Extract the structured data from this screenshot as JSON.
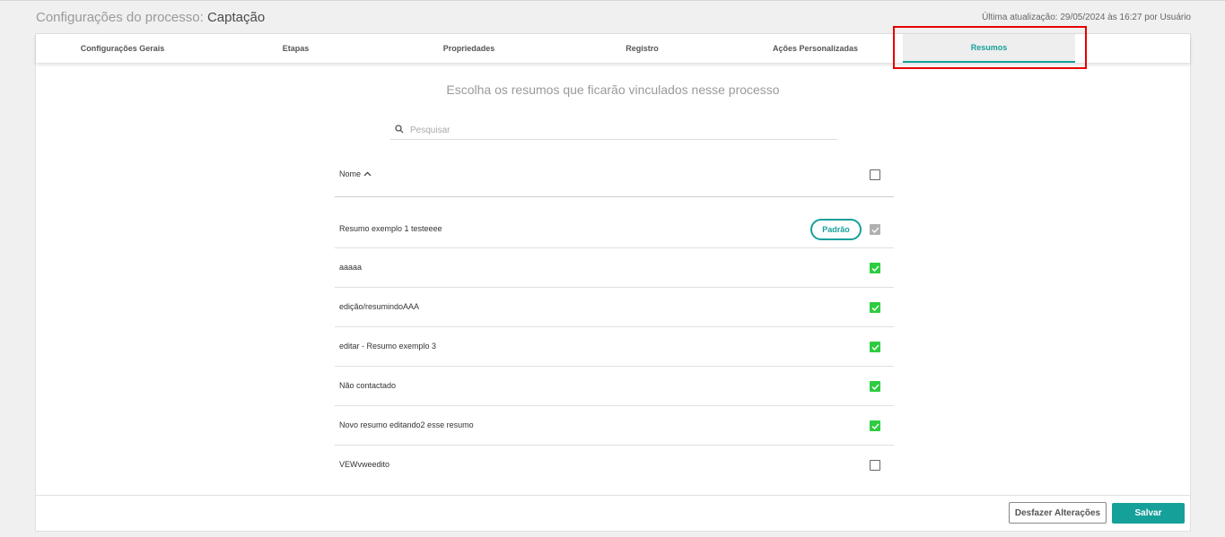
{
  "header": {
    "title_prefix": "Configurações do processo:",
    "title_name": "Captação",
    "last_update": "Última atualização: 29/05/2024 às 16:27 por Usuário"
  },
  "tabs": [
    {
      "label": "Configurações Gerais",
      "active": false
    },
    {
      "label": "Etapas",
      "active": false
    },
    {
      "label": "Propriedades",
      "active": false
    },
    {
      "label": "Registro",
      "active": false
    },
    {
      "label": "Ações Personalizadas",
      "active": false
    },
    {
      "label": "Resumos",
      "active": true
    }
  ],
  "main": {
    "subtitle": "Escolha os resumos que ficarão vinculados nesse processo",
    "search_placeholder": "Pesquisar",
    "column_name": "Nome",
    "default_badge": "Padrão",
    "rows": [
      {
        "label": "Resumo exemplo 1 testeeee",
        "state": "disabled",
        "default": true
      },
      {
        "label": "aaaaa",
        "state": "checked"
      },
      {
        "label": "edição/resumindoAAA",
        "state": "checked"
      },
      {
        "label": "editar - Resumo exemplo 3",
        "state": "checked"
      },
      {
        "label": "Não contactado",
        "state": "checked"
      },
      {
        "label": "Novo resumo editando2 esse resumo",
        "state": "checked"
      },
      {
        "label": "VEWvweedito",
        "state": "unchecked"
      }
    ]
  },
  "footer": {
    "undo_label": "Desfazer Alterações",
    "save_label": "Salvar"
  },
  "colors": {
    "accent": "#16a09a",
    "check_green": "#2ecc40",
    "highlight_red": "#e60000"
  }
}
